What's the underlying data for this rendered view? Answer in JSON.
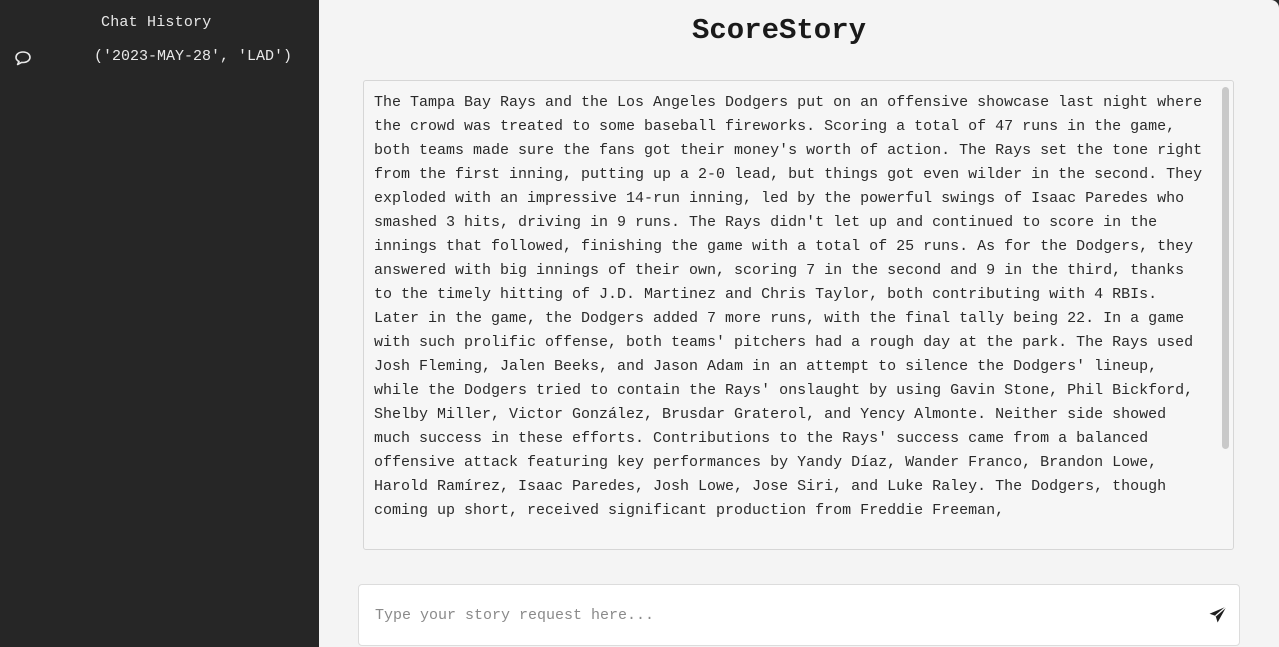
{
  "sidebar": {
    "title": "Chat History",
    "items": [
      {
        "label": "('2023-MAY-28', 'LAD')",
        "icon": "chat-bubble-icon"
      }
    ]
  },
  "main": {
    "title": "ScoreStory",
    "story": "The Tampa Bay Rays and the Los Angeles Dodgers put on an offensive showcase last night where the crowd was treated to some baseball fireworks. Scoring a total of 47 runs in the game, both teams made sure the fans got their money's worth of action. The Rays set the tone right from the first inning, putting up a 2-0 lead, but things got even wilder in the second. They exploded with an impressive 14-run inning, led by the powerful swings of Isaac Paredes who smashed 3 hits, driving in 9 runs. The Rays didn't let up and continued to score in the innings that followed, finishing the game with a total of 25 runs. As for the Dodgers, they answered with big innings of their own, scoring 7 in the second and 9 in the third, thanks to the timely hitting of J.D. Martinez and Chris Taylor, both contributing with 4 RBIs. Later in the game, the Dodgers added 7 more runs, with the final tally being 22. In a game with such prolific offense, both teams' pitchers had a rough day at the park. The Rays used Josh Fleming, Jalen Beeks, and Jason Adam in an attempt to silence the Dodgers' lineup, while the Dodgers tried to contain the Rays' onslaught by using Gavin Stone, Phil Bickford, Shelby Miller, Victor González, Brusdar Graterol, and Yency Almonte. Neither side showed much success in these efforts. Contributions to the Rays' success came from a balanced offensive attack featuring key performances by Yandy Díaz, Wander Franco, Brandon Lowe, Harold Ramírez, Isaac Paredes, Josh Lowe, Jose Siri, and Luke Raley. The Dodgers, though coming up short, received significant production from Freddie Freeman,",
    "input": {
      "placeholder": "Type your story request here...",
      "value": ""
    },
    "send_icon": "send-icon"
  }
}
